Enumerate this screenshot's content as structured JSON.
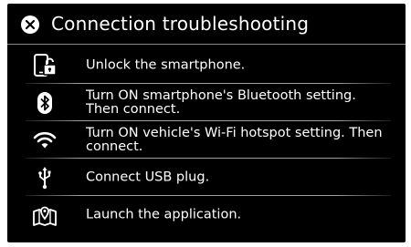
{
  "dialog": {
    "title": "Connection troubleshooting",
    "close_icon": "circle-x-icon"
  },
  "items": [
    {
      "icon": "smartphone-unlock-icon",
      "label": "Unlock the smartphone."
    },
    {
      "icon": "bluetooth-icon",
      "label": "Turn ON smartphone's Bluetooth setting. Then connect."
    },
    {
      "icon": "wifi-icon",
      "label": "Turn ON vehicle's Wi-Fi hotspot setting. Then connect."
    },
    {
      "icon": "usb-icon",
      "label": "Connect USB plug."
    },
    {
      "icon": "map-pin-icon",
      "label": "Launch the application."
    }
  ],
  "colors": {
    "background": "#000000",
    "text": "#ffffff",
    "divider": "#c8c8c8"
  }
}
